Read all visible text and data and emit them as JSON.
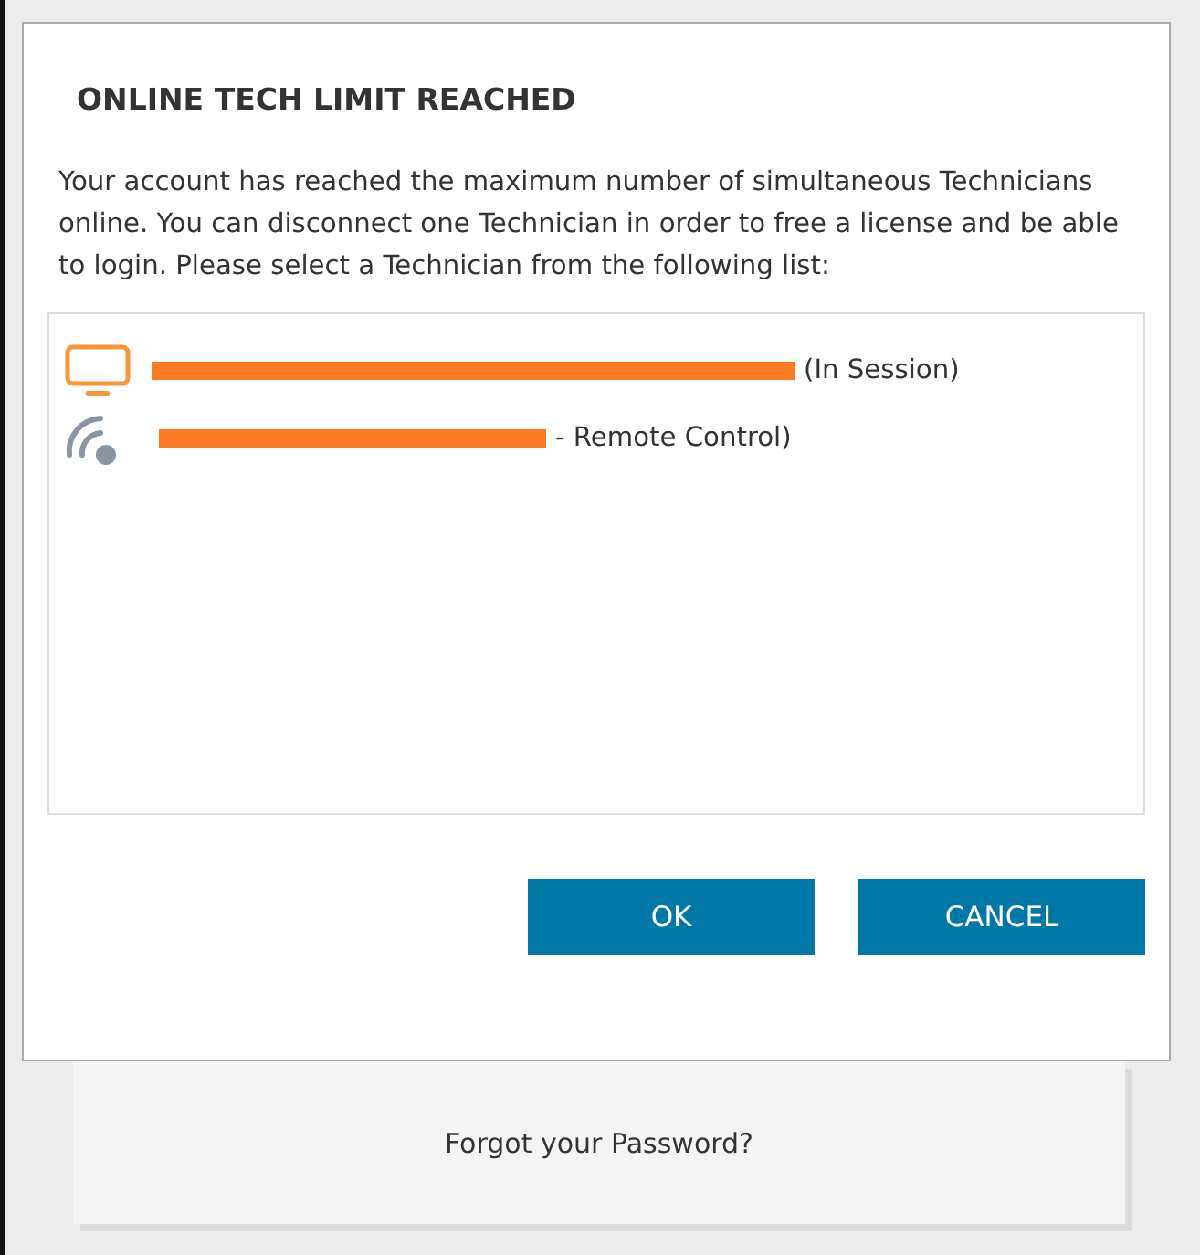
{
  "dialog": {
    "title": "ONLINE TECH LIMIT REACHED",
    "message": "Your account has reached the maximum number of simultaneous Technicians online. You can disconnect one Technician in order to free a license and be able to login. Please select a Technician from the following list:",
    "technicians": [
      {
        "kind": "console",
        "suffix": "(In Session)",
        "redacted": true
      },
      {
        "kind": "remote",
        "suffix": "- Remote Control)",
        "redacted": true
      }
    ],
    "buttons": [
      "OK",
      "CANCEL"
    ]
  },
  "login": {
    "forgot_link": "Forgot your Password?"
  }
}
